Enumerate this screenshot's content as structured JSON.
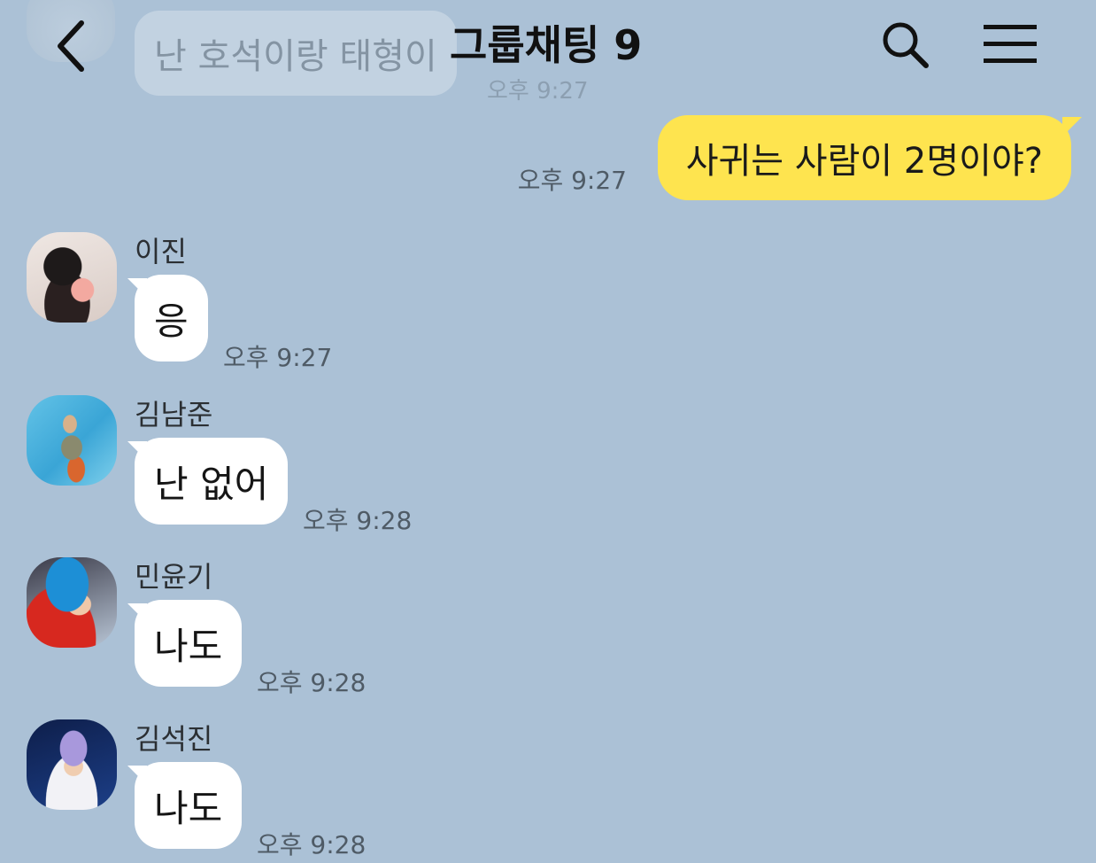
{
  "header": {
    "title": "그룹채팅 9"
  },
  "ghost_message": {
    "text": "난 호석이랑 태형이",
    "time": "오후 9:27"
  },
  "my_message": {
    "text": "사귀는 사람이 2명이야?",
    "time": "오후 9:27"
  },
  "messages": [
    {
      "sender": "이진",
      "text": "응",
      "time": "오후 9:27"
    },
    {
      "sender": "김남준",
      "text": "난 없어",
      "time": "오후 9:28"
    },
    {
      "sender": "민윤기",
      "text": "나도",
      "time": "오후 9:28"
    },
    {
      "sender": "김석진",
      "text": "나도",
      "time": "오후 9:28"
    }
  ],
  "colors": {
    "background": "#abc1d6",
    "my_bubble": "#fee44f",
    "other_bubble": "#ffffff"
  },
  "icons": [
    "back-arrow-icon",
    "search-icon",
    "menu-icon"
  ]
}
